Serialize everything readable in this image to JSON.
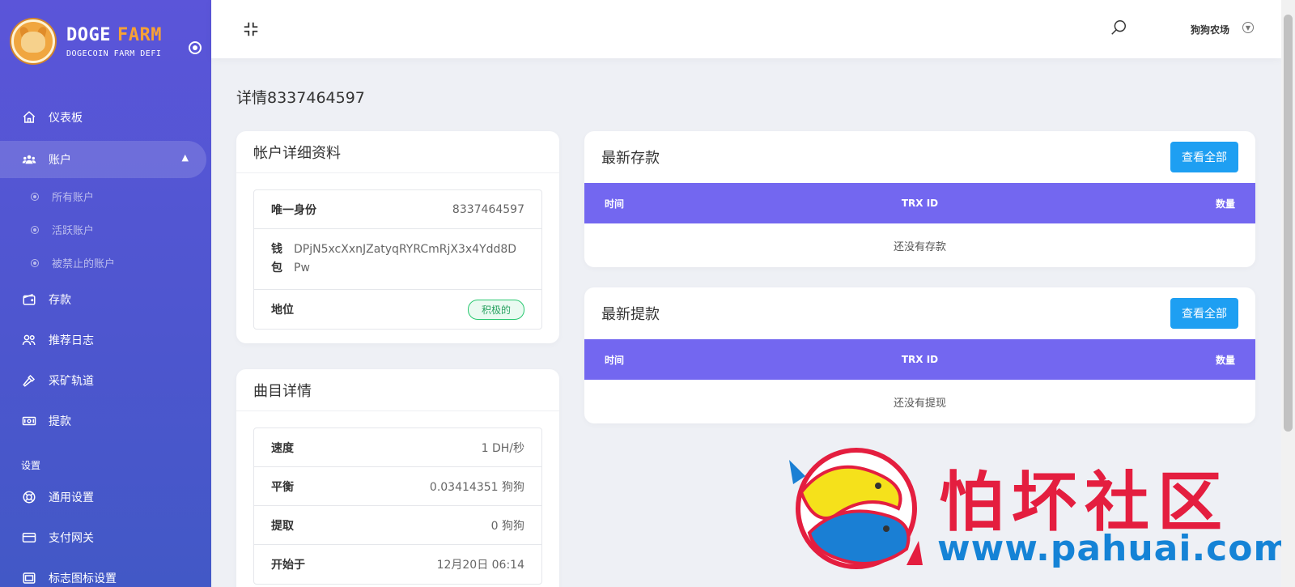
{
  "brand": {
    "title_part1": "DOGE",
    "title_part2": "FARM",
    "subtitle": "DOGECOIN FARM DEFI",
    "accent_color": "#f7a136"
  },
  "sidebar": {
    "items": [
      {
        "label": "仪表板",
        "icon": "home-icon"
      },
      {
        "label": "账户",
        "icon": "users-icon",
        "expanded": true
      },
      {
        "label": "存款",
        "icon": "wallet-icon"
      },
      {
        "label": "推荐日志",
        "icon": "referral-icon"
      },
      {
        "label": "采矿轨道",
        "icon": "hammer-icon"
      },
      {
        "label": "提款",
        "icon": "cash-icon"
      }
    ],
    "sub_items": [
      "所有账户",
      "活跃账户",
      "被禁止的账户"
    ],
    "section_label": "设置",
    "settings_items": [
      {
        "label": "通用设置",
        "icon": "life-ring-icon"
      },
      {
        "label": "支付网关",
        "icon": "credit-card-icon"
      },
      {
        "label": "标志图标设置",
        "icon": "image-icon"
      }
    ]
  },
  "header": {
    "user_name": "狗狗农场"
  },
  "page": {
    "title": "详情8337464597"
  },
  "account_card": {
    "title": "帐户详细资料",
    "rows": {
      "uid_label": "唯一身份",
      "uid_value": "8337464597",
      "wallet_label": "钱包",
      "wallet_value": "DPjN5xcXxnJZatyqRYRCmRjX3x4Ydd8DPw",
      "status_label": "地位",
      "status_value": "积极的"
    }
  },
  "plan_card": {
    "title": "曲目详情",
    "rows": [
      {
        "label": "速度",
        "value": "1 DH/秒"
      },
      {
        "label": "平衡",
        "value": "0.03414351 狗狗"
      },
      {
        "label": "提取",
        "value": "0 狗狗"
      },
      {
        "label": "开始于",
        "value": "12月20日 06:14"
      }
    ]
  },
  "deposits_card": {
    "title": "最新存款",
    "button": "查看全部",
    "columns": [
      "时间",
      "TRX ID",
      "数量"
    ],
    "empty": "还没有存款"
  },
  "withdrawals_card": {
    "title": "最新提款",
    "button": "查看全部",
    "columns": [
      "时间",
      "TRX ID",
      "数量"
    ],
    "empty": "还没有提现"
  },
  "watermark": {
    "text": "怕坏社区",
    "url": "www.pahuai.com"
  },
  "colors": {
    "sidebar": "#5b55d9",
    "table_header": "#7367f0",
    "button": "#1e9ff2",
    "badge": "#28c76f"
  }
}
